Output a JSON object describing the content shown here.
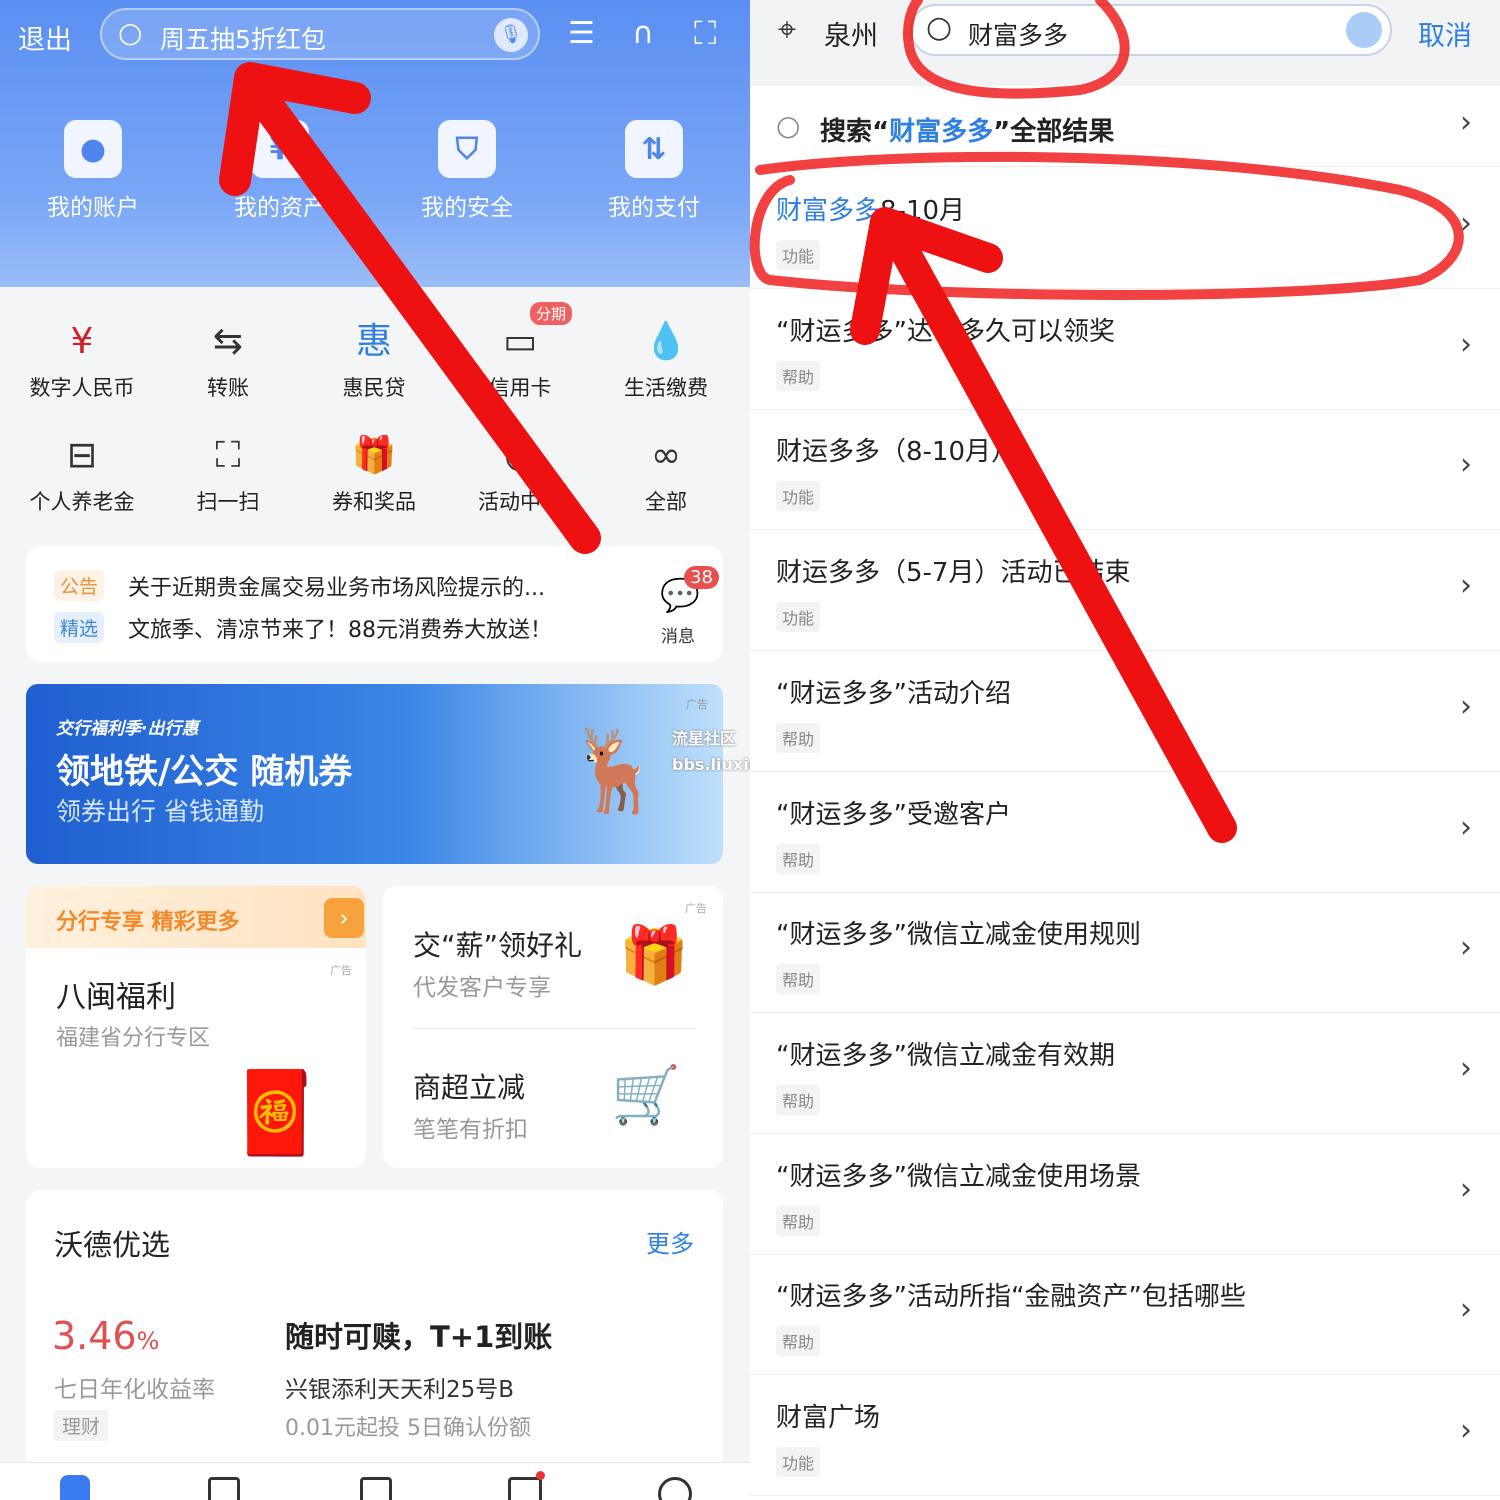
{
  "left": {
    "header": {
      "exit": "退出",
      "search_placeholder": "周五抽5折红包"
    },
    "accounts": [
      {
        "label": "我的账户",
        "icon": "user-icon"
      },
      {
        "label": "我的资产",
        "icon": "asset-icon"
      },
      {
        "label": "我的安全",
        "icon": "shield-icon"
      },
      {
        "label": "我的支付",
        "icon": "payment-icon"
      }
    ],
    "grid": [
      {
        "label": "数字人民币",
        "icon": "ecny-icon"
      },
      {
        "label": "转账",
        "icon": "transfer-icon"
      },
      {
        "label": "惠民贷",
        "icon": "loan-icon"
      },
      {
        "label": "信用卡",
        "icon": "credit-card-icon",
        "badge": "分期"
      },
      {
        "label": "生活缴费",
        "icon": "utility-icon"
      },
      {
        "label": "个人养老金",
        "icon": "pension-icon"
      },
      {
        "label": "扫一扫",
        "icon": "scan-icon"
      },
      {
        "label": "券和奖品",
        "icon": "gift-icon"
      },
      {
        "label": "活动中心",
        "icon": "activity-icon"
      },
      {
        "label": "全部",
        "icon": "all-apps-icon"
      }
    ],
    "notice": {
      "tag1": "公告",
      "text1": "关于近期贵金属交易业务市场风险提示的...",
      "tag2": "精选",
      "text2": "文旅季、清凉节来了！88元消费券大放送！",
      "msg_label": "消息",
      "msg_count": "38"
    },
    "banner": {
      "small": "交行福利季·出行惠",
      "title": "领地铁/公交 随机券",
      "sub": "领券出行 省钱通勤",
      "ad": "广告"
    },
    "branch": {
      "header": "分行专享 精彩更多",
      "title": "八闽福利",
      "sub": "福建省分行专区",
      "ad": "广告"
    },
    "promo1": {
      "title": "交“薪”领好礼",
      "sub": "代发客户专享",
      "ad": "广告"
    },
    "promo2": {
      "title": "商超立减",
      "sub": "笔笔有折扣"
    },
    "wealth": {
      "title": "沃德优选",
      "more": "更多",
      "rate": "3.46",
      "pct": "%",
      "rate_label": "七日年化收益率",
      "tag": "理财",
      "headline": "随时可赎，T+1到账",
      "product": "兴银添利天天利25号B",
      "desc": "0.01元起投 5日确认份额"
    },
    "watermark": {
      "line1": "流星社区",
      "line2": "bbs.liuxingw.com"
    }
  },
  "right": {
    "city": "泉州",
    "query": "财富多多",
    "cancel": "取消",
    "search_all": {
      "prefix": "搜索“",
      "kw": "财富多多",
      "suffix": "”全部结果"
    },
    "results": [
      {
        "hl": "财富多多",
        "rest": "8-10月",
        "tag": "功能"
      },
      {
        "hl": "",
        "rest": "“财运多多”达标多久可以领奖",
        "tag": "帮助"
      },
      {
        "hl": "",
        "rest": "财运多多（8-10月）",
        "tag": "功能"
      },
      {
        "hl": "",
        "rest": "财运多多（5-7月）活动已结束",
        "tag": "功能"
      },
      {
        "hl": "",
        "rest": "“财运多多”活动介绍",
        "tag": "帮助"
      },
      {
        "hl": "",
        "rest": "“财运多多”受邀客户",
        "tag": "帮助"
      },
      {
        "hl": "",
        "rest": "“财运多多”微信立减金使用规则",
        "tag": "帮助"
      },
      {
        "hl": "",
        "rest": "“财运多多”微信立减金有效期",
        "tag": "帮助"
      },
      {
        "hl": "",
        "rest": "“财运多多”微信立减金使用场景",
        "tag": "帮助"
      },
      {
        "hl": "",
        "rest": "“财运多多”活动所指“金融资产”包括哪些",
        "tag": "帮助"
      },
      {
        "hl": "",
        "rest": "财富广场",
        "tag": "功能"
      }
    ]
  },
  "colors": {
    "annotation": "#ee1111",
    "brand_blue": "#5a8ff2",
    "highlight": "#2f7fe0",
    "rate_red": "#e05050"
  }
}
